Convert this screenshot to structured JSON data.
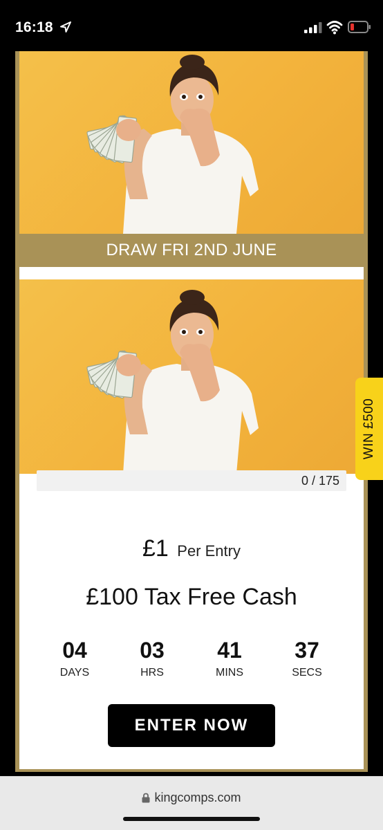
{
  "status_bar": {
    "time": "16:18",
    "icons": [
      "location-arrow-icon",
      "cellular-signal-icon",
      "wifi-icon",
      "battery-low-icon"
    ],
    "battery_color": "#e5322d"
  },
  "competition": {
    "draw_banner": "DRAW FRI 2ND JUNE",
    "progress": {
      "text": "0 / 175",
      "sold": 0,
      "total": 175,
      "fraction": 0
    },
    "price": {
      "amount": "£1",
      "suffix": "Per Entry"
    },
    "prize_title": "£100 Tax Free Cash",
    "countdown": [
      {
        "value": "04",
        "label": "DAYS"
      },
      {
        "value": "03",
        "label": "HRS"
      },
      {
        "value": "41",
        "label": "MINS"
      },
      {
        "value": "37",
        "label": "SECS"
      }
    ],
    "enter_button": "ENTER NOW"
  },
  "side_tab": {
    "label": "WIN £500",
    "color": "#f8d21a"
  },
  "browser": {
    "url": "kingcomps.com",
    "icon": "lock-icon"
  },
  "colors": {
    "accent_gold": "#a99257",
    "photo_background": "#f3b33c",
    "button": "#000000"
  }
}
